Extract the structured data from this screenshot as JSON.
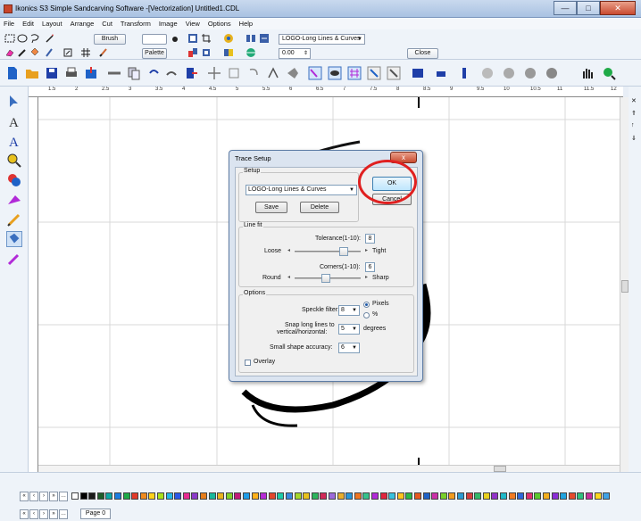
{
  "window": {
    "title": "Ikonics S3 Simple Sandcarving Software -[Vectorization] Untitled1.CDL",
    "minimize": "—",
    "maximize": "□",
    "close": "✕"
  },
  "menu": [
    "File",
    "Edit",
    "Layout",
    "Arrange",
    "Cut",
    "Transform",
    "Image",
    "View",
    "Options",
    "Help"
  ],
  "toolbar1": {
    "brush_label": "Brush",
    "palette_label": "Palette",
    "preset_select": "LOGO-Long Lines & Curves",
    "value_field": "0.00",
    "close_label": "Close"
  },
  "ruler": {
    "labels": [
      "1.5",
      "2",
      "2.5",
      "3",
      "3.5",
      "4",
      "4.5",
      "5",
      "5.5",
      "6",
      "6.5",
      "7",
      "7.5",
      "8",
      "8.5",
      "9",
      "9.5",
      "10",
      "10.5",
      "11",
      "11.5",
      "12"
    ]
  },
  "dialog": {
    "title": "Trace Setup",
    "close": "x",
    "setup_label": "Setup",
    "setup_select": "LOGO-Long Lines & Curves",
    "save_label": "Save",
    "delete_label": "Delete",
    "ok_label": "OK",
    "cancel_label": "Cancel",
    "linefit_label": "Line fit",
    "tolerance_label": "Tolerance(1-10):",
    "tolerance_value": "8",
    "loose_label": "Loose",
    "tight_label": "Tight",
    "corners_label": "Corners(1-10):",
    "corners_value": "6",
    "round_label": "Round",
    "sharp_label": "Sharp",
    "options_label": "Options",
    "speckle_label": "Speckle filter:",
    "speckle_value": "8",
    "pixels_label": "Pixels",
    "percent_label": "%",
    "snap_label_1": "Snap long lines to",
    "snap_label_2": "vertical/horizontal:",
    "snap_value": "5",
    "degrees_label": "degrees",
    "small_shape_label": "Small shape accuracy:",
    "small_shape_value": "6",
    "overlay_label": "Overlay"
  },
  "bottom": {
    "page_tab": "Page 0"
  },
  "swatch_colors": [
    "#ffffff",
    "#000000",
    "#1a1a1a",
    "#1e5d2a",
    "#0da7a4",
    "#1d7de0",
    "#1faa47",
    "#e23a2a",
    "#f08a1f",
    "#ffd21a",
    "#a8e01a",
    "#22b7e8",
    "#2b58e8",
    "#e82a92",
    "#8b3ac9",
    "#e67d1b",
    "#18b79b",
    "#e8b21e",
    "#7ed12a",
    "#c31a7a",
    "#1d9ce8",
    "#ffb01a",
    "#b52bd6",
    "#e2462c",
    "#1ccaa8",
    "#3b87e0",
    "#a4d62b",
    "#e8c11e",
    "#2cb55d",
    "#d12a58",
    "#9c6adb",
    "#e8ae2b",
    "#2696d8",
    "#f07420",
    "#35c28c",
    "#b12ad8",
    "#e1243e",
    "#36c2df",
    "#ffc31d",
    "#2ab848",
    "#e6581f",
    "#1f62c7",
    "#ca30a8",
    "#78cf2a",
    "#f29b1e",
    "#2a9ad1",
    "#d63d3d",
    "#33b86a",
    "#e8d01e",
    "#9132c8",
    "#1fb8c9",
    "#f07a22",
    "#2d67d9",
    "#df2f6f",
    "#5ac82e",
    "#f2ae1e",
    "#8a2ed6",
    "#1fa3df",
    "#e44b2c",
    "#2ec07e",
    "#c92f9c",
    "#ffd81e",
    "#3fa2e6"
  ]
}
